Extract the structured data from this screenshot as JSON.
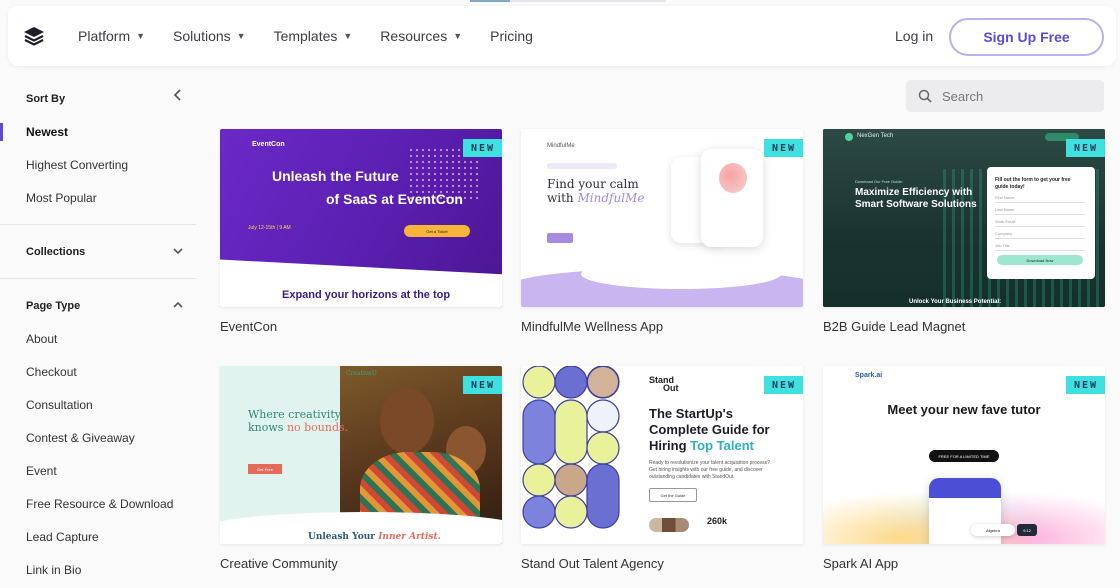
{
  "header": {
    "nav": [
      {
        "label": "Platform",
        "caret": true
      },
      {
        "label": "Solutions",
        "caret": true
      },
      {
        "label": "Templates",
        "caret": true
      },
      {
        "label": "Resources",
        "caret": true
      },
      {
        "label": "Pricing",
        "caret": false
      }
    ],
    "login": "Log in",
    "signup": "Sign Up Free"
  },
  "sidebar": {
    "sort_by": {
      "title": "Sort By",
      "items": [
        "Newest",
        "Highest Converting",
        "Most Popular"
      ],
      "active": "Newest"
    },
    "collections": {
      "title": "Collections"
    },
    "page_type": {
      "title": "Page Type",
      "items": [
        "About",
        "Checkout",
        "Consultation",
        "Contest & Giveaway",
        "Event",
        "Free Resource & Download",
        "Lead Capture",
        "Link in Bio"
      ]
    }
  },
  "search": {
    "placeholder": "Search"
  },
  "colors": {
    "accent": "#5b4bd6",
    "badge": "#3fe0e0",
    "signup_border": "#b9b1ef"
  },
  "templates": [
    {
      "title": "EventCon",
      "badge": "NEW",
      "thumb": {
        "logo": "EventCon",
        "headline_1": "Unleash the Future",
        "headline_2": "of SaaS at EventCon",
        "date": "July 12-15th | 9 AM",
        "button": "Get a Ticket",
        "footer": "Expand your horizons at the top"
      }
    },
    {
      "title": "MindfulMe Wellness App",
      "badge": "NEW",
      "thumb": {
        "logo": "MindfulMe",
        "headline_1": "Find your calm",
        "headline_2_pre": "with ",
        "headline_2_accent": "MindfulMe"
      }
    },
    {
      "title": "B2B Guide Lead Magnet",
      "badge": "NEW",
      "thumb": {
        "brand": "NexGen Tech",
        "kicker": "Download Our Free Guide:",
        "headline": "Maximize Efficiency with Smart Software Solutions",
        "form_title": "Fill out the form to get your free guide today!",
        "form_fields": [
          "First Name",
          "Last Name",
          "Work Email",
          "Company",
          "Job Title"
        ],
        "form_button": "Download Now",
        "footer": "Unlock Your Business Potential:"
      }
    },
    {
      "title": "Creative Community",
      "badge": "NEW",
      "thumb": {
        "logo": "CreativeU",
        "headline_1": "Where creativity",
        "headline_2_pre": "knows ",
        "headline_2_accent": "no bounds.",
        "button": "Get Free",
        "footer_pre": "Unleash Your ",
        "footer_accent": "Inner Artist."
      }
    },
    {
      "title": "Stand Out Talent Agency",
      "badge": "NEW",
      "thumb": {
        "logo_1": "Stand",
        "logo_2": "Out",
        "headline_1": "The StartUp's",
        "headline_2": "Complete Guide for",
        "headline_3_pre": "Hiring ",
        "headline_3_accent": "Top Talent",
        "body": "Ready to revolutionize your talent acquisition process? Get hiring insights with our free guide, and discover outstanding candidates with StandOut.",
        "button": "Get the Guide",
        "stat": "260k"
      }
    },
    {
      "title": "Spark AI App",
      "badge": "NEW",
      "thumb": {
        "logo": "Spark.ai",
        "headline": "Meet your new fave tutor",
        "button": "FREE FOR A LIMITED TIME",
        "chip_1": "Algebra",
        "chip_2": "9:12"
      }
    }
  ]
}
